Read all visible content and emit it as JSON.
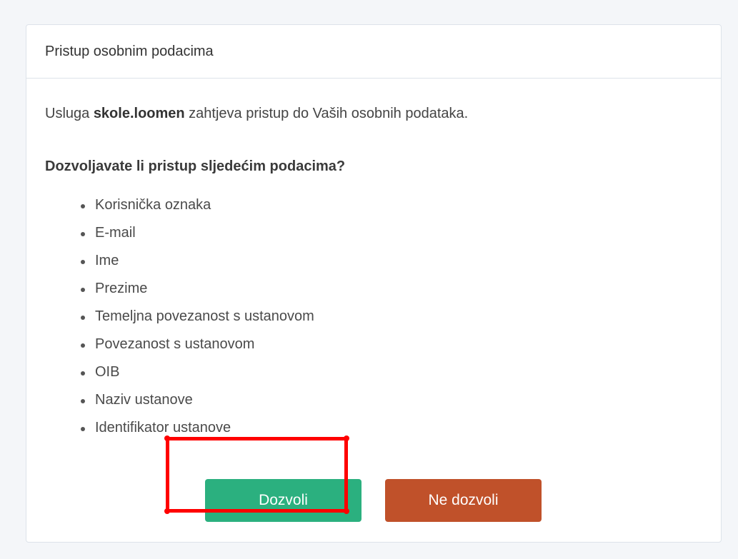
{
  "card": {
    "title": "Pristup osobnim podacima",
    "intro_prefix": "Usluga ",
    "service_name": "skole.loomen",
    "intro_suffix": " zahtjeva pristup do Vaših osobnih podataka.",
    "question": "Dozvoljavate li pristup sljedećim podacima?",
    "attributes": [
      "Korisnička oznaka",
      "E-mail",
      "Ime",
      "Prezime",
      "Temeljna povezanost s ustanovom",
      "Povezanost s ustanovom",
      "OIB",
      "Naziv ustanove",
      "Identifikator ustanove"
    ]
  },
  "actions": {
    "allow_label": "Dozvoli",
    "deny_label": "Ne dozvoli"
  },
  "colors": {
    "allow": "#2bb07f",
    "deny": "#c0512a",
    "highlight": "#ff0000"
  }
}
